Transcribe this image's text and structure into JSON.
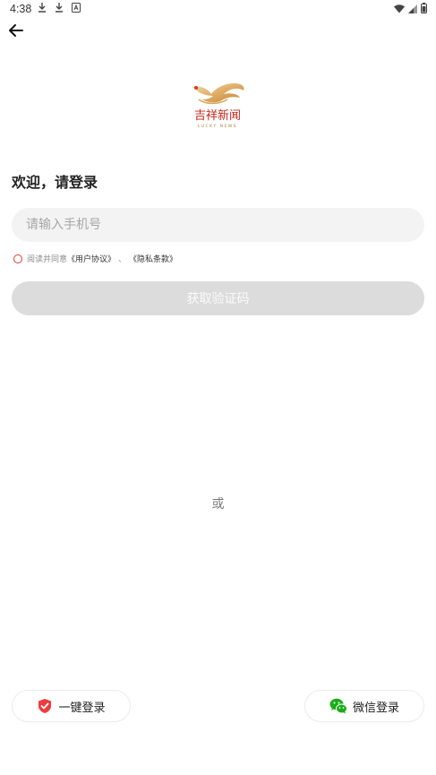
{
  "status_bar": {
    "time": "4:38",
    "left_icons": [
      "download-icon",
      "download-icon",
      "a-icon"
    ],
    "right_icons": [
      "wifi-icon",
      "signal-icon",
      "battery-icon"
    ]
  },
  "header": {
    "back_icon": "arrow-left-icon"
  },
  "logo": {
    "brand_cn": "吉祥新闻",
    "brand_en": "LUCKY NEWS"
  },
  "welcome": "欢迎，请登录",
  "phone": {
    "placeholder": "请输入手机号",
    "value": ""
  },
  "agreement": {
    "prefix": "阅读并同意",
    "user_agreement": "《用户协议》",
    "separator": "、",
    "privacy_terms": "《隐私条款》"
  },
  "get_code_label": "获取验证码",
  "or_text": "或",
  "alt_login": {
    "one_click_label": "一键登录",
    "wechat_label": "微信登录"
  },
  "colors": {
    "accent": "#e03a3a",
    "wechat": "#1aad19",
    "disabled_button": "#dcdcdc",
    "input_bg": "#f3f3f3"
  }
}
